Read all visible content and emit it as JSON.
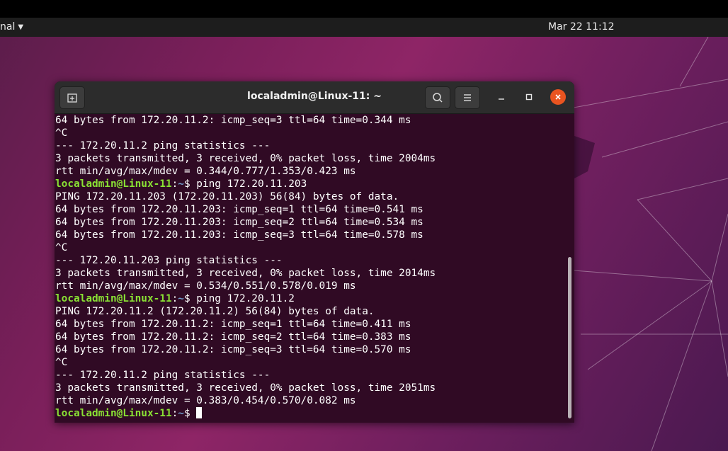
{
  "topbar": {
    "app_name": "nal",
    "clock": "Mar 22  11:12"
  },
  "window": {
    "title": "localadmin@Linux-11: ~"
  },
  "terminal": {
    "lines": [
      {
        "type": "out",
        "text": "64 bytes from 172.20.11.2: icmp_seq=3 ttl=64 time=0.344 ms"
      },
      {
        "type": "out",
        "text": "^C"
      },
      {
        "type": "out",
        "text": "--- 172.20.11.2 ping statistics ---"
      },
      {
        "type": "out",
        "text": "3 packets transmitted, 3 received, 0% packet loss, time 2004ms"
      },
      {
        "type": "out",
        "text": "rtt min/avg/max/mdev = 0.344/0.777/1.353/0.423 ms"
      },
      {
        "type": "prompt",
        "user": "localadmin@Linux-11",
        "path": "~",
        "cmd": " ping 172.20.11.203"
      },
      {
        "type": "out",
        "text": "PING 172.20.11.203 (172.20.11.203) 56(84) bytes of data."
      },
      {
        "type": "out",
        "text": "64 bytes from 172.20.11.203: icmp_seq=1 ttl=64 time=0.541 ms"
      },
      {
        "type": "out",
        "text": "64 bytes from 172.20.11.203: icmp_seq=2 ttl=64 time=0.534 ms"
      },
      {
        "type": "out",
        "text": "64 bytes from 172.20.11.203: icmp_seq=3 ttl=64 time=0.578 ms"
      },
      {
        "type": "out",
        "text": "^C"
      },
      {
        "type": "out",
        "text": "--- 172.20.11.203 ping statistics ---"
      },
      {
        "type": "out",
        "text": "3 packets transmitted, 3 received, 0% packet loss, time 2014ms"
      },
      {
        "type": "out",
        "text": "rtt min/avg/max/mdev = 0.534/0.551/0.578/0.019 ms"
      },
      {
        "type": "prompt",
        "user": "localadmin@Linux-11",
        "path": "~",
        "cmd": " ping 172.20.11.2"
      },
      {
        "type": "out",
        "text": "PING 172.20.11.2 (172.20.11.2) 56(84) bytes of data."
      },
      {
        "type": "out",
        "text": "64 bytes from 172.20.11.2: icmp_seq=1 ttl=64 time=0.411 ms"
      },
      {
        "type": "out",
        "text": "64 bytes from 172.20.11.2: icmp_seq=2 ttl=64 time=0.383 ms"
      },
      {
        "type": "out",
        "text": "64 bytes from 172.20.11.2: icmp_seq=3 ttl=64 time=0.570 ms"
      },
      {
        "type": "out",
        "text": "^C"
      },
      {
        "type": "out",
        "text": "--- 172.20.11.2 ping statistics ---"
      },
      {
        "type": "out",
        "text": "3 packets transmitted, 3 received, 0% packet loss, time 2051ms"
      },
      {
        "type": "out",
        "text": "rtt min/avg/max/mdev = 0.383/0.454/0.570/0.082 ms"
      },
      {
        "type": "prompt",
        "user": "localadmin@Linux-11",
        "path": "~",
        "cmd": " ",
        "cursor": true
      }
    ]
  },
  "colors": {
    "terminal_bg": "#300a24",
    "prompt_user": "#8ae234",
    "prompt_path": "#729fcf",
    "close_button": "#e95420"
  },
  "icons": {
    "new_tab": "new-tab-icon",
    "search": "search-icon",
    "menu": "hamburger-menu-icon",
    "minimize": "minimize-icon",
    "maximize": "maximize-icon",
    "close": "close-icon"
  }
}
